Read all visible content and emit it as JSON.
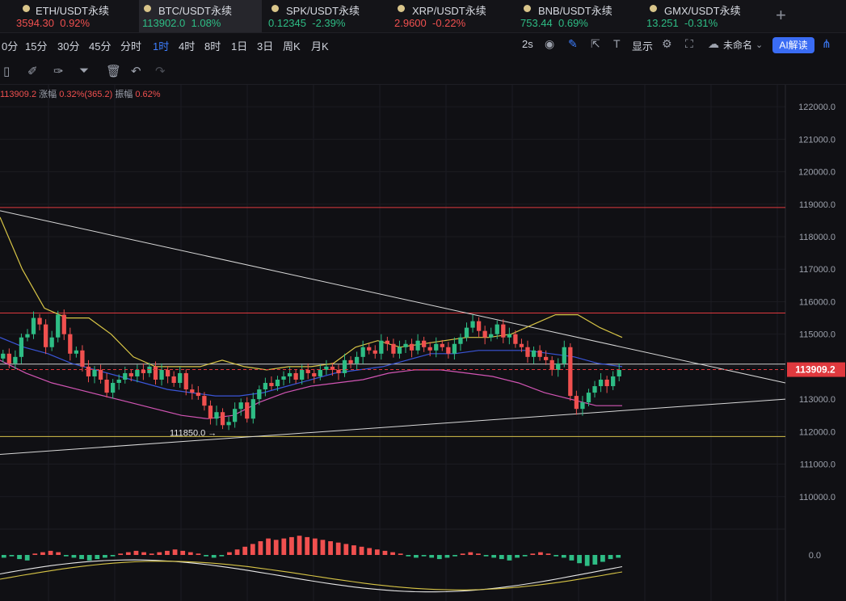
{
  "tabs": [
    {
      "symbol": "ETH/USDT永续",
      "price": "3594.30",
      "change": "0.92%",
      "dir": "down",
      "active": false
    },
    {
      "symbol": "BTC/USDT永续",
      "price": "113902.0",
      "change": "1.08%",
      "dir": "up",
      "active": true
    },
    {
      "symbol": "SPK/USDT永续",
      "price": "0.12345",
      "change": "-2.39%",
      "dir": "up",
      "active": false
    },
    {
      "symbol": "XRP/USDT永续",
      "price": "2.9600",
      "change": "-0.22%",
      "dir": "down",
      "active": false
    },
    {
      "symbol": "BNB/USDT永续",
      "price": "753.44",
      "change": "0.69%",
      "dir": "up",
      "active": false
    },
    {
      "symbol": "GMX/USDT永续",
      "price": "13.251",
      "change": "-0.31%",
      "dir": "up",
      "active": false
    }
  ],
  "add_tab": "+",
  "timeframes": [
    "0分",
    "15分",
    "30分",
    "45分",
    "分时",
    "1时",
    "4时",
    "8时",
    "1日",
    "3日",
    "周K",
    "月K"
  ],
  "active_timeframe": "1时",
  "toolbar": {
    "interval_label": "2s",
    "display_label": "显示",
    "layout_name": "未命名",
    "ai_label": "AI解读"
  },
  "info_bar": {
    "close": "113909.2",
    "change_label": "涨幅",
    "change_value": "0.32%(365.2)",
    "amplitude_label": "振幅",
    "amplitude_value": "0.62%"
  },
  "price_axis": [
    "122000.0",
    "121000.0",
    "120000.0",
    "119000.0",
    "118000.0",
    "117000.0",
    "116000.0",
    "115000.0",
    "114000.0",
    "113000.0",
    "112000.0",
    "111000.0",
    "110000.0"
  ],
  "last_price_tag": "113909.2",
  "low_marker": "111850.0",
  "macd_axis_label": "0.0",
  "colors": {
    "up": "#2ebd85",
    "down": "#f0504f",
    "accent": "#3d7eff",
    "tag_bg": "#e0393e"
  },
  "chart_data": {
    "type": "candlestick",
    "ylim": [
      109000,
      122700
    ],
    "horizontal_levels": [
      {
        "price": 118900,
        "color": "#e0393e"
      },
      {
        "price": 115650,
        "color": "#e0393e"
      },
      {
        "price": 114080,
        "color": "#d0d0d0"
      },
      {
        "price": 111850,
        "color": "#d6c24a"
      }
    ],
    "trend_lines": [
      {
        "from": [
          0,
          118800
        ],
        "to": [
          100,
          113500
        ]
      },
      {
        "from": [
          0,
          111300
        ],
        "to": [
          100,
          113000
        ]
      }
    ],
    "closes": [
      114400,
      114100,
      114300,
      114900,
      115000,
      115500,
      115300,
      114600,
      114900,
      115600,
      115000,
      114400,
      114500,
      114000,
      113700,
      113900,
      113600,
      113200,
      113500,
      113600,
      113800,
      113700,
      113900,
      113800,
      114000,
      113600,
      113900,
      113700,
      113500,
      113800,
      113300,
      113200,
      113100,
      112800,
      112400,
      112600,
      112200,
      112300,
      112700,
      112900,
      112400,
      113000,
      113300,
      113500,
      113400,
      113600,
      113700,
      113800,
      113600,
      113900,
      113800,
      113700,
      113900,
      114000,
      113900,
      113800,
      114200,
      114100,
      114300,
      114600,
      114500,
      114400,
      114800,
      114700,
      114400,
      114600,
      114700,
      114500,
      114800,
      114600,
      114500,
      114700,
      114600,
      114400,
      114700,
      114900,
      115200,
      115400,
      115100,
      114900,
      115000,
      115300,
      114900,
      115000,
      114700,
      114600,
      114300,
      114500,
      114300,
      114200,
      113900,
      114100,
      114600,
      113100,
      112700,
      112900,
      113200,
      113400,
      113600,
      113400,
      113700,
      113900
    ],
    "ma_upper": [
      118600,
      117000,
      115800,
      115500,
      115500,
      115000,
      114300,
      114000,
      114000,
      114000,
      114200,
      114000,
      113900,
      114000,
      114000,
      114100,
      114600,
      114800,
      114600,
      114700,
      114800,
      114900,
      114900,
      115000,
      115300,
      115600,
      115600,
      115200,
      114900
    ],
    "ma_mid": [
      114900,
      114600,
      114400,
      114100,
      113900,
      113700,
      113500,
      113300,
      113200,
      113100,
      113100,
      113200,
      113400,
      113600,
      113800,
      113900,
      114000,
      114200,
      114400,
      114400,
      114500,
      114500,
      114500,
      114400,
      114300,
      114100,
      114000
    ],
    "ma_lower": [
      114200,
      113800,
      113500,
      113300,
      113100,
      112900,
      112700,
      112500,
      112400,
      112500,
      112900,
      113200,
      113400,
      113500,
      113600,
      113800,
      113900,
      113900,
      113800,
      113700,
      113500,
      113200,
      113000,
      112800,
      112800
    ],
    "macd_hist": [
      -2,
      -1,
      -3,
      -4,
      1,
      2,
      3,
      2,
      -1,
      -2,
      -3,
      -4,
      -3,
      -2,
      -1,
      1,
      2,
      3,
      2,
      1,
      2,
      3,
      4,
      3,
      2,
      1,
      -1,
      -2,
      -1,
      2,
      4,
      6,
      8,
      10,
      12,
      11,
      12,
      13,
      14,
      13,
      12,
      11,
      10,
      9,
      8,
      7,
      6,
      5,
      4,
      3,
      2,
      1,
      -1,
      -2,
      -1,
      -2,
      -3,
      -2,
      -1,
      1,
      2,
      1,
      -1,
      -2,
      -3,
      -4,
      -2,
      -1,
      1,
      2,
      1,
      -1,
      -2,
      -4,
      -6,
      -8,
      -7,
      -5,
      -3,
      -2
    ]
  }
}
